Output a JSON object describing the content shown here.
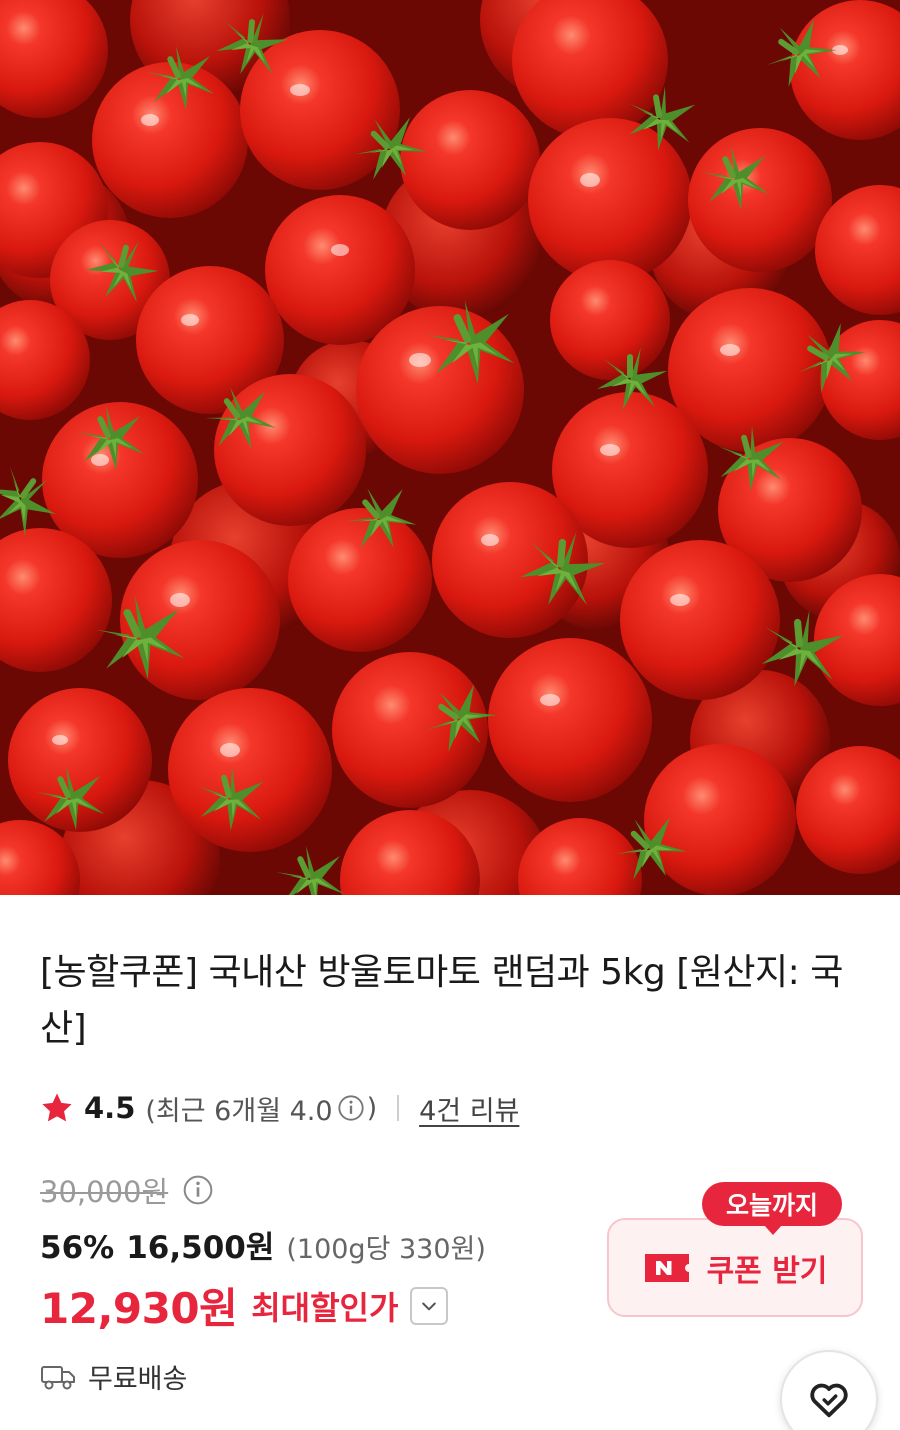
{
  "product": {
    "title": "[농할쿠폰] 국내산 방울토마토 랜덤과 5kg [원산지: 국산]",
    "image_alt": "방울토마토"
  },
  "rating": {
    "score": "4.5",
    "recent_prefix": "(최근 6개월 4.0",
    "recent_suffix": ")",
    "review_link": "4건 리뷰"
  },
  "price": {
    "original": "30,000원",
    "discount_rate": "56%",
    "sale_price": "16,500원",
    "unit_price": "(100g당 330원)",
    "max_discount_price": "12,930원",
    "max_discount_label": "최대할인가"
  },
  "shipping": {
    "label": "무료배송"
  },
  "coupon": {
    "badge": "오늘까지",
    "button_label": "쿠폰 받기"
  },
  "icons": {
    "star": "star-icon",
    "info": "info-icon",
    "chevron": "chevron-down-icon",
    "truck": "truck-icon",
    "coupon": "n-ticket-icon",
    "wishlist": "heart-icon"
  },
  "colors": {
    "accent": "#e7263d",
    "star": "#e7263d",
    "coupon_bg": "#fdf1f2"
  }
}
